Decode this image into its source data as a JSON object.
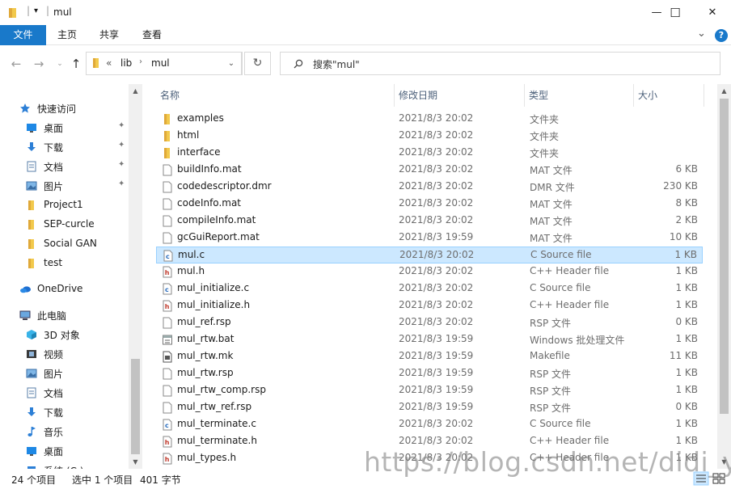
{
  "window": {
    "title": "mul",
    "controls": {
      "minimize": "—",
      "maximize": "☐",
      "close": "✕"
    }
  },
  "ribbon": {
    "tabs": [
      "文件",
      "主页",
      "共享",
      "查看"
    ],
    "expand": "⌄",
    "help": "?"
  },
  "address": {
    "overflow": "«",
    "crumbs": [
      "lib",
      "mul"
    ],
    "search_placeholder": "搜索\"mul\""
  },
  "nav": {
    "items": [
      {
        "label": "快速访问",
        "icon": "star-icon",
        "pinned": false
      },
      {
        "label": "桌面",
        "icon": "desktop-icon",
        "pinned": true
      },
      {
        "label": "下载",
        "icon": "download-icon",
        "pinned": true
      },
      {
        "label": "文档",
        "icon": "document-icon",
        "pinned": true
      },
      {
        "label": "图片",
        "icon": "picture-icon",
        "pinned": true
      },
      {
        "label": "Project1",
        "icon": "folder-icon",
        "pinned": false
      },
      {
        "label": "SEP-curcle",
        "icon": "folder-icon",
        "pinned": false
      },
      {
        "label": "Social GAN",
        "icon": "folder-icon",
        "pinned": false
      },
      {
        "label": "test",
        "icon": "folder-icon",
        "pinned": false
      },
      {
        "label": "OneDrive",
        "icon": "cloud-icon",
        "pinned": false
      },
      {
        "label": "此电脑",
        "icon": "computer-icon",
        "pinned": false
      },
      {
        "label": "3D 对象",
        "icon": "cube-icon",
        "pinned": false
      },
      {
        "label": "视频",
        "icon": "video-icon",
        "pinned": false
      },
      {
        "label": "图片",
        "icon": "picture-icon",
        "pinned": false
      },
      {
        "label": "文档",
        "icon": "document-icon",
        "pinned": false
      },
      {
        "label": "下载",
        "icon": "download-icon",
        "pinned": false
      },
      {
        "label": "音乐",
        "icon": "music-icon",
        "pinned": false
      },
      {
        "label": "桌面",
        "icon": "desktop-icon",
        "pinned": false
      },
      {
        "label": "系统 (C:)",
        "icon": "drive-icon",
        "pinned": false
      }
    ]
  },
  "columns": {
    "name": "名称",
    "date": "修改日期",
    "type": "类型",
    "size": "大小"
  },
  "files": [
    {
      "name": "examples",
      "date": "2021/8/3 20:02",
      "type": "文件夹",
      "size": "",
      "icon": "folder"
    },
    {
      "name": "html",
      "date": "2021/8/3 20:02",
      "type": "文件夹",
      "size": "",
      "icon": "folder"
    },
    {
      "name": "interface",
      "date": "2021/8/3 20:02",
      "type": "文件夹",
      "size": "",
      "icon": "folder"
    },
    {
      "name": "buildInfo.mat",
      "date": "2021/8/3 20:02",
      "type": "MAT 文件",
      "size": "6 KB",
      "icon": "blank"
    },
    {
      "name": "codedescriptor.dmr",
      "date": "2021/8/3 20:02",
      "type": "DMR 文件",
      "size": "230 KB",
      "icon": "blank"
    },
    {
      "name": "codeInfo.mat",
      "date": "2021/8/3 20:02",
      "type": "MAT 文件",
      "size": "8 KB",
      "icon": "blank"
    },
    {
      "name": "compileInfo.mat",
      "date": "2021/8/3 20:02",
      "type": "MAT 文件",
      "size": "2 KB",
      "icon": "blank"
    },
    {
      "name": "gcGuiReport.mat",
      "date": "2021/8/3 19:59",
      "type": "MAT 文件",
      "size": "10 KB",
      "icon": "blank"
    },
    {
      "name": "mul.c",
      "date": "2021/8/3 20:02",
      "type": "C Source file",
      "size": "1 KB",
      "icon": "c",
      "selected": true
    },
    {
      "name": "mul.h",
      "date": "2021/8/3 20:02",
      "type": "C++ Header file",
      "size": "1 KB",
      "icon": "h"
    },
    {
      "name": "mul_initialize.c",
      "date": "2021/8/3 20:02",
      "type": "C Source file",
      "size": "1 KB",
      "icon": "c"
    },
    {
      "name": "mul_initialize.h",
      "date": "2021/8/3 20:02",
      "type": "C++ Header file",
      "size": "1 KB",
      "icon": "h"
    },
    {
      "name": "mul_ref.rsp",
      "date": "2021/8/3 20:02",
      "type": "RSP 文件",
      "size": "0 KB",
      "icon": "blank"
    },
    {
      "name": "mul_rtw.bat",
      "date": "2021/8/3 19:59",
      "type": "Windows 批处理文件",
      "size": "1 KB",
      "icon": "bat"
    },
    {
      "name": "mul_rtw.mk",
      "date": "2021/8/3 19:59",
      "type": "Makefile",
      "size": "11 KB",
      "icon": "mk"
    },
    {
      "name": "mul_rtw.rsp",
      "date": "2021/8/3 19:59",
      "type": "RSP 文件",
      "size": "1 KB",
      "icon": "blank"
    },
    {
      "name": "mul_rtw_comp.rsp",
      "date": "2021/8/3 19:59",
      "type": "RSP 文件",
      "size": "1 KB",
      "icon": "blank"
    },
    {
      "name": "mul_rtw_ref.rsp",
      "date": "2021/8/3 19:59",
      "type": "RSP 文件",
      "size": "0 KB",
      "icon": "blank"
    },
    {
      "name": "mul_terminate.c",
      "date": "2021/8/3 20:02",
      "type": "C Source file",
      "size": "1 KB",
      "icon": "c"
    },
    {
      "name": "mul_terminate.h",
      "date": "2021/8/3 20:02",
      "type": "C++ Header file",
      "size": "1 KB",
      "icon": "h"
    },
    {
      "name": "mul_types.h",
      "date": "2021/8/3 20:02",
      "type": "C++ Header file",
      "size": "1 KB",
      "icon": "h"
    }
  ],
  "status": {
    "count": "24 个项目",
    "selection": "选中 1 个项目",
    "selection_size": "401 字节"
  },
  "watermark": "https://blog.csdn.net/didi_ya",
  "colors": {
    "accent": "#1979ca",
    "selection_bg": "#cce8ff",
    "selection_border": "#99d1ff",
    "folder": "#f2c94c"
  }
}
